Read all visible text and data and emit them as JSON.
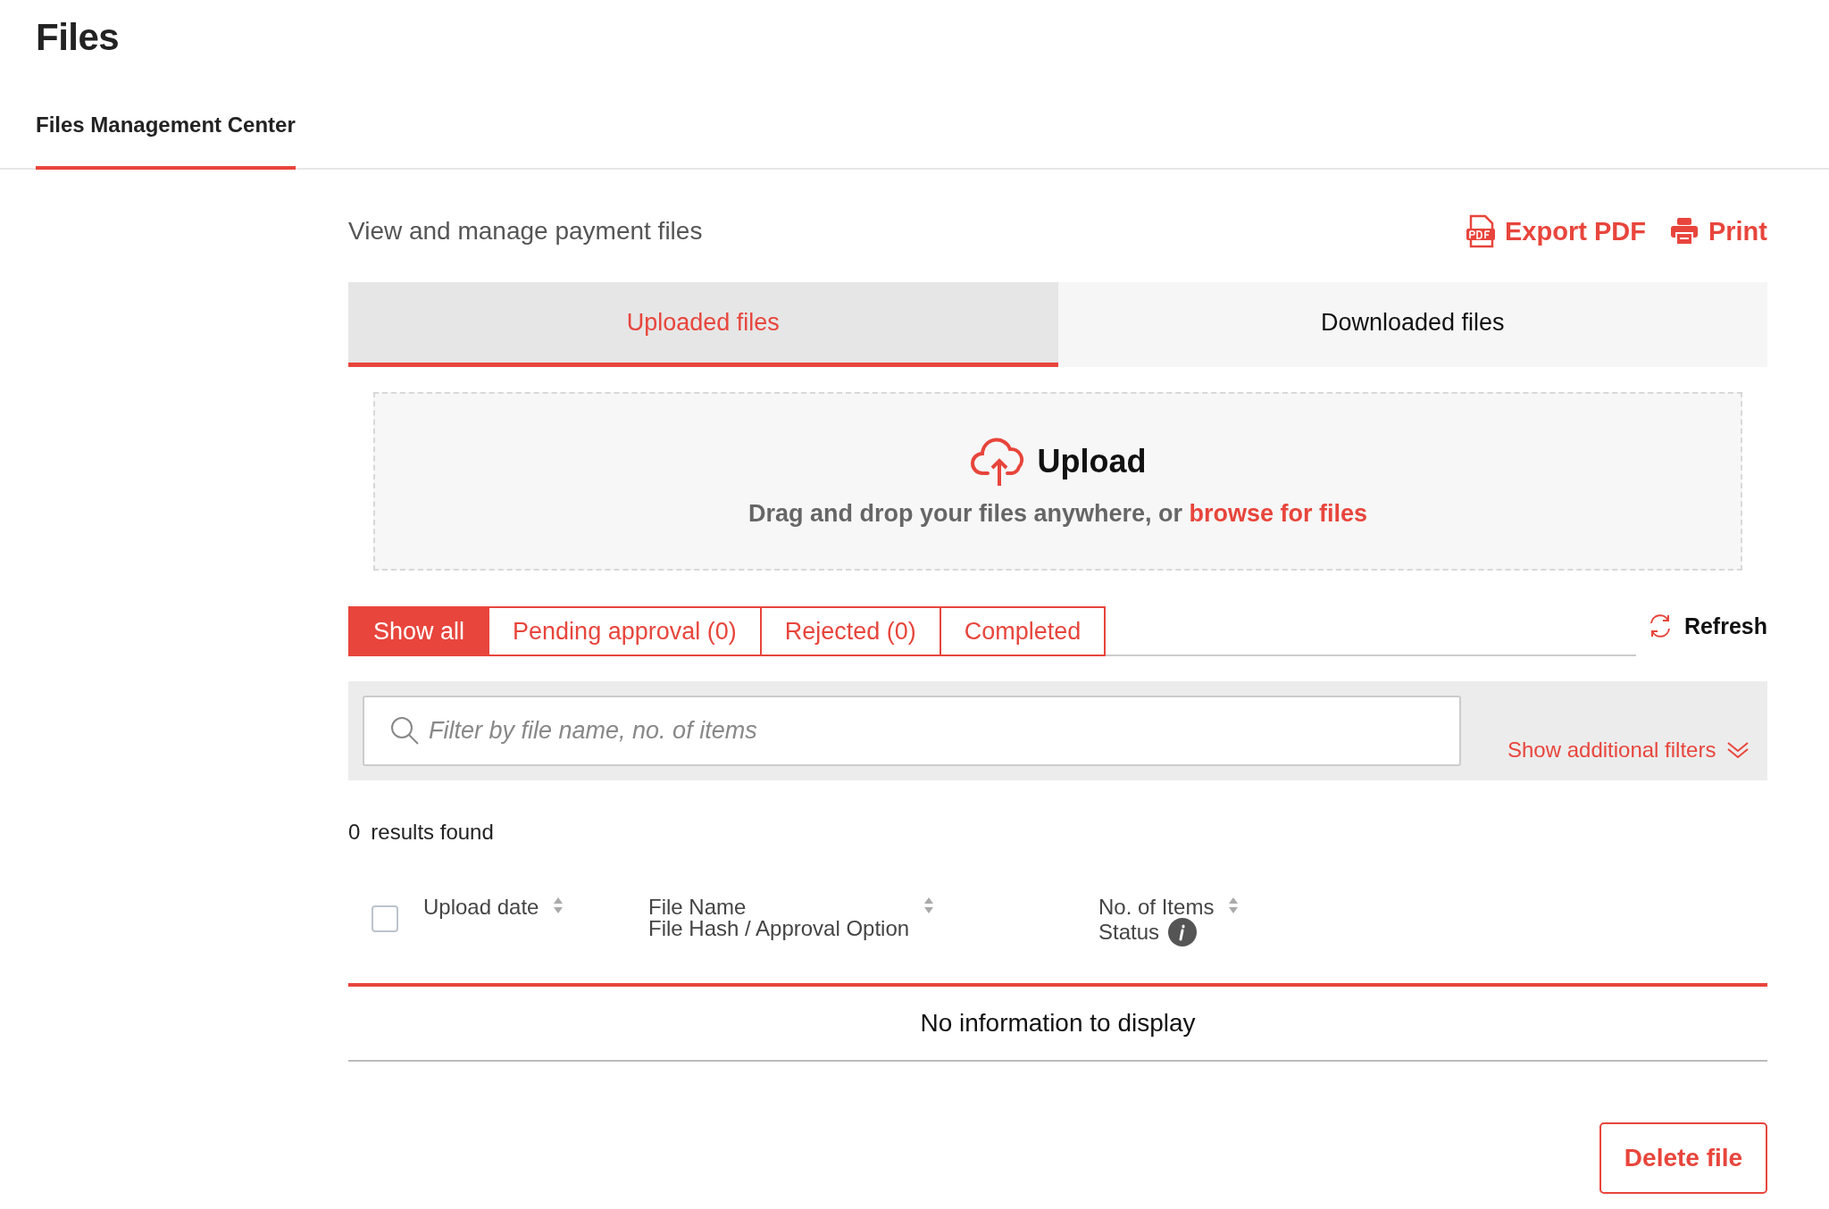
{
  "page": {
    "title": "Files"
  },
  "nav_tabs": [
    {
      "label": "Files Management Center",
      "selected": true
    }
  ],
  "subtitle": "View and manage payment files",
  "actions": [
    {
      "kind": "pdf",
      "label": "Export PDF"
    },
    {
      "kind": "print",
      "label": "Print"
    }
  ],
  "file_tabs": [
    {
      "label": "Uploaded files",
      "selected": true
    },
    {
      "label": "Downloaded files",
      "selected": false
    }
  ],
  "upload": {
    "title": "Upload",
    "text": "Drag and drop your files anywhere, or ",
    "link": "browse for files"
  },
  "status_filters": [
    {
      "label": "Show all",
      "selected": true
    },
    {
      "label": "Pending approval (0)",
      "selected": false
    },
    {
      "label": "Rejected (0)",
      "selected": false
    },
    {
      "label": "Completed",
      "selected": false
    }
  ],
  "refresh": "Refresh",
  "search": {
    "placeholder": "Filter by file name, no. of items"
  },
  "additional_filters": "Show additional filters",
  "results": {
    "count": "0",
    "label": "results found"
  },
  "table": {
    "select_all": {
      "checked": false
    },
    "columns": [
      {
        "sortable": true,
        "lines": [
          {
            "text": "Upload date",
            "info": false
          }
        ]
      },
      {
        "sortable": true,
        "lines": [
          {
            "text": "File Name",
            "info": false
          },
          {
            "text": "File Hash / Approval Option",
            "info": false
          }
        ]
      },
      {
        "sortable": true,
        "lines": [
          {
            "text": "No. of Items",
            "info": false
          },
          {
            "text": "Status",
            "info": true
          }
        ]
      }
    ],
    "empty_text": "No information to display"
  },
  "buttons": [
    {
      "label": "Delete file"
    }
  ]
}
